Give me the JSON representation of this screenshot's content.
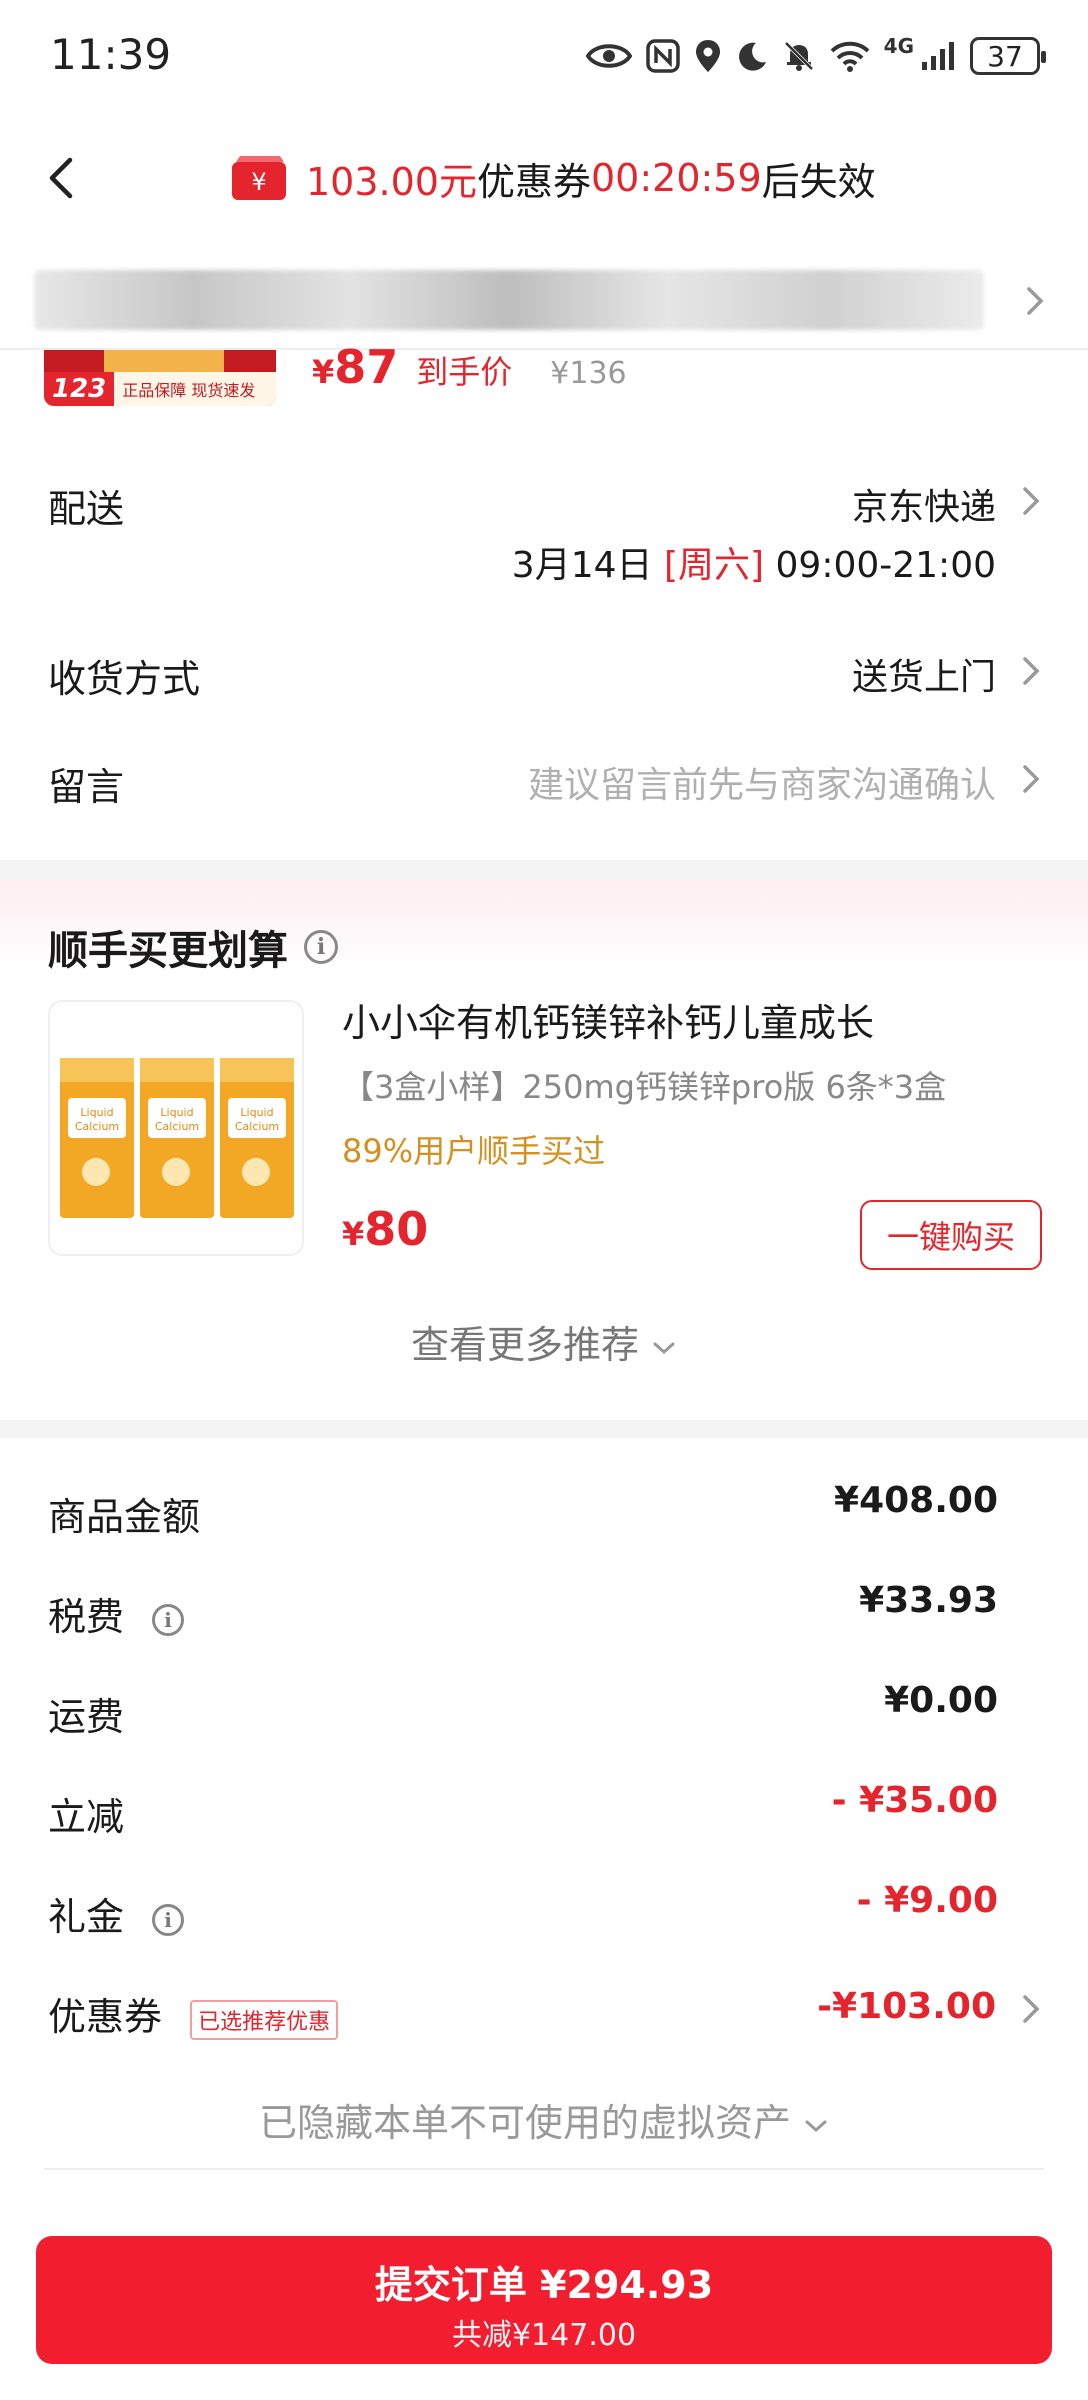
{
  "status_bar": {
    "time": "11:39",
    "network": "4G",
    "battery": "37"
  },
  "header": {
    "coupon_amount": "103.00元",
    "coupon_label": "优惠券",
    "countdown": "00:20:59",
    "countdown_suffix": "后失效"
  },
  "product": {
    "thumb_price": "123",
    "thumb_label": "正品保障 现货速发",
    "price_symbol": "¥",
    "price": "87",
    "price_tag": "到手价",
    "original_price": "¥136"
  },
  "delivery": {
    "label": "配送",
    "carrier": "京东快递",
    "date": "3月14日",
    "weekday": "[周六]",
    "time_window": "09:00-21:00"
  },
  "receive_method": {
    "label": "收货方式",
    "value": "送货上门"
  },
  "message": {
    "label": "留言",
    "placeholder": "建议留言前先与商家沟通确认"
  },
  "bundle": {
    "title": "顺手买更划算",
    "name": "小小伞有机钙镁锌补钙儿童成长",
    "spec": "【3盒小样】250mg钙镁锌pro版 6条*3盒",
    "stat": "89%用户顺手买过",
    "price_symbol": "¥",
    "price": "80",
    "buy_label": "一键购买",
    "more_label": "查看更多推荐"
  },
  "summary": {
    "goods_label": "商品金额",
    "goods_value": "¥408.00",
    "tax_label": "税费",
    "tax_value": "¥33.93",
    "shipping_label": "运费",
    "shipping_value": "¥0.00",
    "discount_label": "立减",
    "discount_value": "- ¥35.00",
    "gift_label": "礼金",
    "gift_value": "- ¥9.00",
    "coupon_label": "优惠券",
    "coupon_badge": "已选推荐优惠",
    "coupon_value": "-¥103.00"
  },
  "hidden_assets_note": "已隐藏本单不可使用的虚拟资产",
  "submit": {
    "label": "提交订单 ¥294.93",
    "saving": "共减¥147.00"
  },
  "colors": {
    "accent": "#e4252d",
    "button": "#f21d2e"
  }
}
